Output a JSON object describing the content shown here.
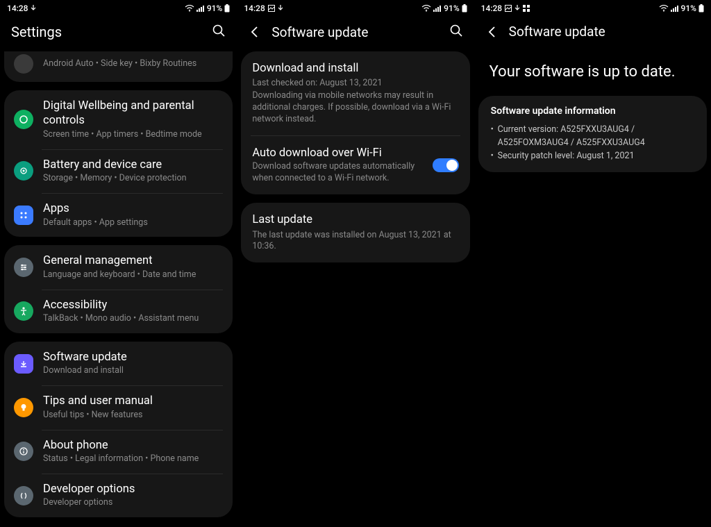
{
  "status": {
    "time": "14:28",
    "battery_text": "91%"
  },
  "panel1": {
    "title": "Settings",
    "partial": {
      "sub": "Android Auto  •  Side key  •  Bixby Routines"
    },
    "group_b": [
      {
        "title": "Digital Wellbeing and parental controls",
        "sub": "Screen time  •  App timers  •  Bedtime mode"
      },
      {
        "title": "Battery and device care",
        "sub": "Storage  •  Memory  •  Device protection"
      },
      {
        "title": "Apps",
        "sub": "Default apps  •  App settings"
      }
    ],
    "group_c": [
      {
        "title": "General management",
        "sub": "Language and keyboard  •  Date and time"
      },
      {
        "title": "Accessibility",
        "sub": "TalkBack  •  Mono audio  •  Assistant menu"
      }
    ],
    "group_d": [
      {
        "title": "Software update",
        "sub": "Download and install"
      },
      {
        "title": "Tips and user manual",
        "sub": "Useful tips  •  New features"
      },
      {
        "title": "About phone",
        "sub": "Status  •  Legal information  •  Phone name"
      },
      {
        "title": "Developer options",
        "sub": "Developer options"
      }
    ]
  },
  "panel2": {
    "title": "Software update",
    "download": {
      "title": "Download and install",
      "line1": "Last checked on: August 13, 2021",
      "line2": "Downloading via mobile networks may result in additional charges. If possible, download via a Wi-Fi network instead."
    },
    "auto": {
      "title": "Auto download over Wi-Fi",
      "sub": "Download software updates automatically when connected to a Wi-Fi network."
    },
    "last": {
      "title": "Last update",
      "sub": "The last update was installed on August 13, 2021 at 10:36."
    }
  },
  "panel3": {
    "title": "Software update",
    "hero": "Your software is up to date.",
    "info_title": "Software update information",
    "info_version": "Current version: A525FXXU3AUG4 / A525FOXM3AUG4 / A525FXXU3AUG4",
    "info_patch": "Security patch level: August 1, 2021"
  },
  "colors": {
    "wellbeing": "#0eb061",
    "battery": "#0a9e7f",
    "apps": "#3b7bff",
    "general": "#5b6770",
    "accessibility": "#17a85f",
    "swupdate": "#6b5bff",
    "tips": "#ff9800",
    "about": "#5b6770",
    "dev": "#5b6770"
  }
}
